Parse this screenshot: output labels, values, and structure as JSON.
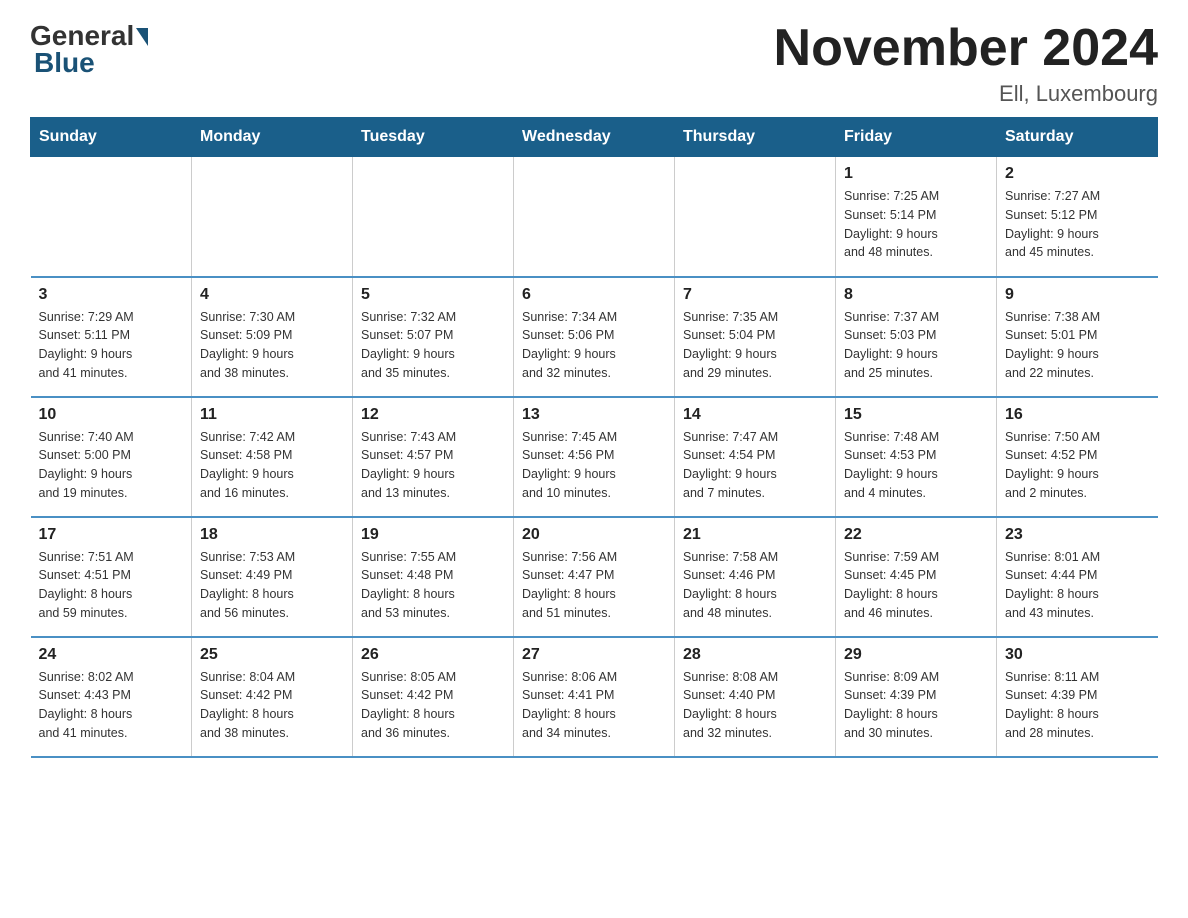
{
  "header": {
    "logo_general": "General",
    "logo_blue": "Blue",
    "month_title": "November 2024",
    "location": "Ell, Luxembourg"
  },
  "weekdays": [
    "Sunday",
    "Monday",
    "Tuesday",
    "Wednesday",
    "Thursday",
    "Friday",
    "Saturday"
  ],
  "weeks": [
    [
      {
        "day": "",
        "info": ""
      },
      {
        "day": "",
        "info": ""
      },
      {
        "day": "",
        "info": ""
      },
      {
        "day": "",
        "info": ""
      },
      {
        "day": "",
        "info": ""
      },
      {
        "day": "1",
        "info": "Sunrise: 7:25 AM\nSunset: 5:14 PM\nDaylight: 9 hours\nand 48 minutes."
      },
      {
        "day": "2",
        "info": "Sunrise: 7:27 AM\nSunset: 5:12 PM\nDaylight: 9 hours\nand 45 minutes."
      }
    ],
    [
      {
        "day": "3",
        "info": "Sunrise: 7:29 AM\nSunset: 5:11 PM\nDaylight: 9 hours\nand 41 minutes."
      },
      {
        "day": "4",
        "info": "Sunrise: 7:30 AM\nSunset: 5:09 PM\nDaylight: 9 hours\nand 38 minutes."
      },
      {
        "day": "5",
        "info": "Sunrise: 7:32 AM\nSunset: 5:07 PM\nDaylight: 9 hours\nand 35 minutes."
      },
      {
        "day": "6",
        "info": "Sunrise: 7:34 AM\nSunset: 5:06 PM\nDaylight: 9 hours\nand 32 minutes."
      },
      {
        "day": "7",
        "info": "Sunrise: 7:35 AM\nSunset: 5:04 PM\nDaylight: 9 hours\nand 29 minutes."
      },
      {
        "day": "8",
        "info": "Sunrise: 7:37 AM\nSunset: 5:03 PM\nDaylight: 9 hours\nand 25 minutes."
      },
      {
        "day": "9",
        "info": "Sunrise: 7:38 AM\nSunset: 5:01 PM\nDaylight: 9 hours\nand 22 minutes."
      }
    ],
    [
      {
        "day": "10",
        "info": "Sunrise: 7:40 AM\nSunset: 5:00 PM\nDaylight: 9 hours\nand 19 minutes."
      },
      {
        "day": "11",
        "info": "Sunrise: 7:42 AM\nSunset: 4:58 PM\nDaylight: 9 hours\nand 16 minutes."
      },
      {
        "day": "12",
        "info": "Sunrise: 7:43 AM\nSunset: 4:57 PM\nDaylight: 9 hours\nand 13 minutes."
      },
      {
        "day": "13",
        "info": "Sunrise: 7:45 AM\nSunset: 4:56 PM\nDaylight: 9 hours\nand 10 minutes."
      },
      {
        "day": "14",
        "info": "Sunrise: 7:47 AM\nSunset: 4:54 PM\nDaylight: 9 hours\nand 7 minutes."
      },
      {
        "day": "15",
        "info": "Sunrise: 7:48 AM\nSunset: 4:53 PM\nDaylight: 9 hours\nand 4 minutes."
      },
      {
        "day": "16",
        "info": "Sunrise: 7:50 AM\nSunset: 4:52 PM\nDaylight: 9 hours\nand 2 minutes."
      }
    ],
    [
      {
        "day": "17",
        "info": "Sunrise: 7:51 AM\nSunset: 4:51 PM\nDaylight: 8 hours\nand 59 minutes."
      },
      {
        "day": "18",
        "info": "Sunrise: 7:53 AM\nSunset: 4:49 PM\nDaylight: 8 hours\nand 56 minutes."
      },
      {
        "day": "19",
        "info": "Sunrise: 7:55 AM\nSunset: 4:48 PM\nDaylight: 8 hours\nand 53 minutes."
      },
      {
        "day": "20",
        "info": "Sunrise: 7:56 AM\nSunset: 4:47 PM\nDaylight: 8 hours\nand 51 minutes."
      },
      {
        "day": "21",
        "info": "Sunrise: 7:58 AM\nSunset: 4:46 PM\nDaylight: 8 hours\nand 48 minutes."
      },
      {
        "day": "22",
        "info": "Sunrise: 7:59 AM\nSunset: 4:45 PM\nDaylight: 8 hours\nand 46 minutes."
      },
      {
        "day": "23",
        "info": "Sunrise: 8:01 AM\nSunset: 4:44 PM\nDaylight: 8 hours\nand 43 minutes."
      }
    ],
    [
      {
        "day": "24",
        "info": "Sunrise: 8:02 AM\nSunset: 4:43 PM\nDaylight: 8 hours\nand 41 minutes."
      },
      {
        "day": "25",
        "info": "Sunrise: 8:04 AM\nSunset: 4:42 PM\nDaylight: 8 hours\nand 38 minutes."
      },
      {
        "day": "26",
        "info": "Sunrise: 8:05 AM\nSunset: 4:42 PM\nDaylight: 8 hours\nand 36 minutes."
      },
      {
        "day": "27",
        "info": "Sunrise: 8:06 AM\nSunset: 4:41 PM\nDaylight: 8 hours\nand 34 minutes."
      },
      {
        "day": "28",
        "info": "Sunrise: 8:08 AM\nSunset: 4:40 PM\nDaylight: 8 hours\nand 32 minutes."
      },
      {
        "day": "29",
        "info": "Sunrise: 8:09 AM\nSunset: 4:39 PM\nDaylight: 8 hours\nand 30 minutes."
      },
      {
        "day": "30",
        "info": "Sunrise: 8:11 AM\nSunset: 4:39 PM\nDaylight: 8 hours\nand 28 minutes."
      }
    ]
  ]
}
